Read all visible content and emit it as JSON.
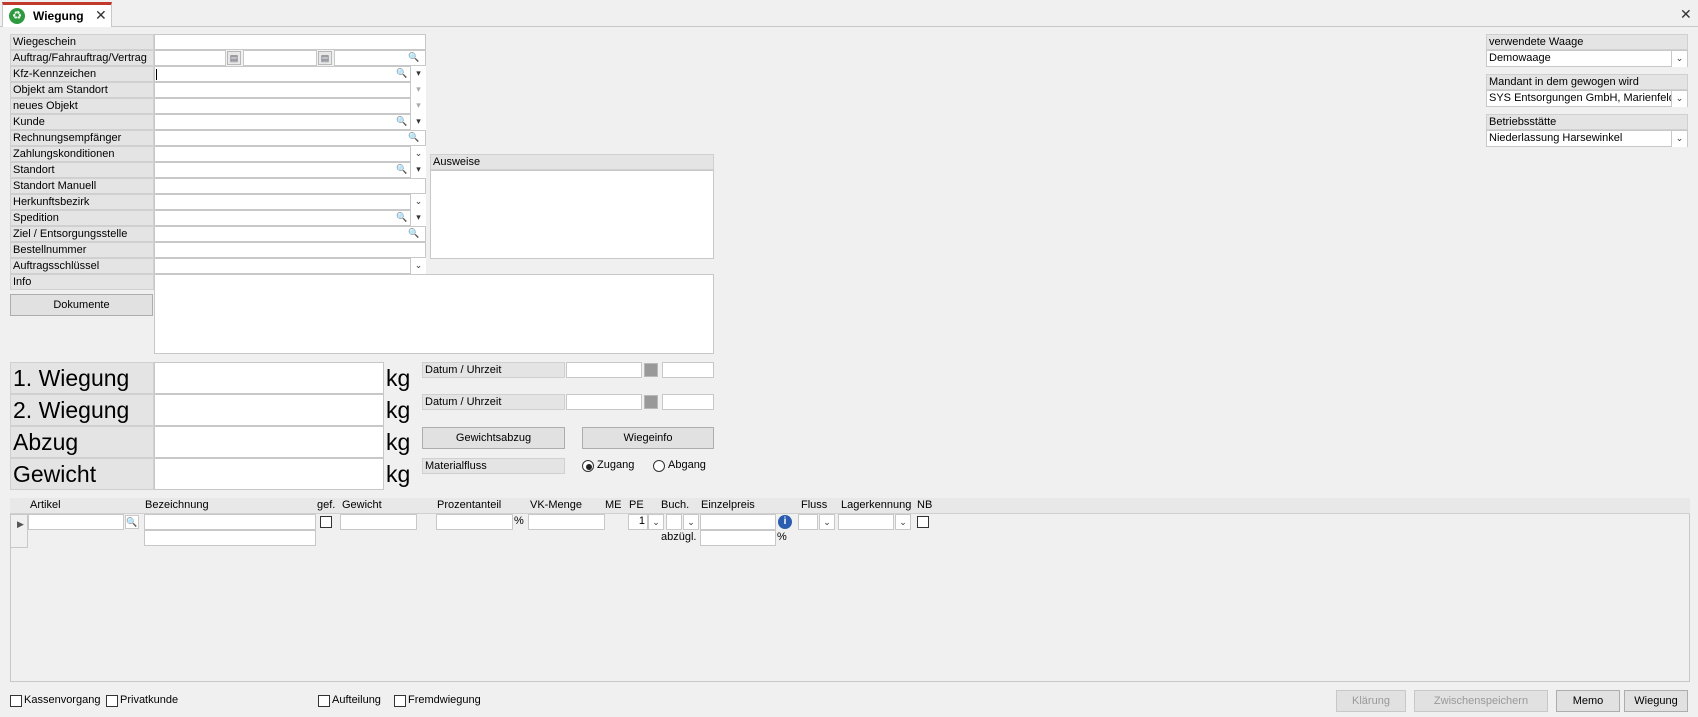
{
  "tab": {
    "title": "Wiegung",
    "close": "✕",
    "icon": "recycle-icon"
  },
  "window": {
    "close": "✕"
  },
  "form": {
    "labels": [
      "Wiegeschein",
      "Auftrag/Fahrauftrag/Vertrag",
      "Kfz-Kennzeichen",
      "Objekt am Standort",
      "neues Objekt",
      "Kunde",
      "Rechnungsempfänger",
      "Zahlungskonditionen",
      "Standort",
      "Standort Manuell",
      "Herkunftsbezirk",
      "Spedition",
      "Ziel / Entsorgungsstelle",
      "Bestellnummer",
      "Auftragsschlüssel",
      "Info"
    ],
    "dokumente": "Dokumente",
    "ausweise": "Ausweise"
  },
  "right": {
    "waage_label": "verwendete Waage",
    "waage_value": "Demowaage",
    "mandant_label": "Mandant in dem gewogen wird",
    "mandant_value": "SYS Entsorgungen GmbH, Marienfeld",
    "betrieb_label": "Betriebsstätte",
    "betrieb_value": "Niederlassung Harsewinkel"
  },
  "weights": {
    "w1": "1. Wiegung",
    "w2": "2. Wiegung",
    "abzug": "Abzug",
    "gewicht": "Gewicht",
    "unit": "kg",
    "datum1": "Datum / Uhrzeit",
    "datum2": "Datum / Uhrzeit",
    "gewichtsabzug": "Gewichtsabzug",
    "wiegeinfo": "Wiegeinfo",
    "materialfluss": "Materialfluss",
    "zugang": "Zugang",
    "abgang": "Abgang"
  },
  "grid": {
    "cols": [
      "Artikel",
      "Bezeichnung",
      "gef.",
      "Gewicht",
      "Prozentanteil",
      "VK-Menge",
      "ME",
      "PE",
      "Buch.",
      "Einzelpreis",
      "Fluss",
      "Lagerkennung",
      "NB"
    ],
    "pe_value": "1",
    "percent": "%",
    "abzugl": "abzügl.",
    "percent2": "%"
  },
  "bottom": {
    "kassenvorgang": "Kassenvorgang",
    "privatkunde": "Privatkunde",
    "aufteilung": "Aufteilung",
    "fremdwiegung": "Fremdwiegung",
    "klaerung": "Klärung",
    "zwischenspeichern": "Zwischenspeichern",
    "memo": "Memo",
    "wiegung": "Wiegung"
  }
}
